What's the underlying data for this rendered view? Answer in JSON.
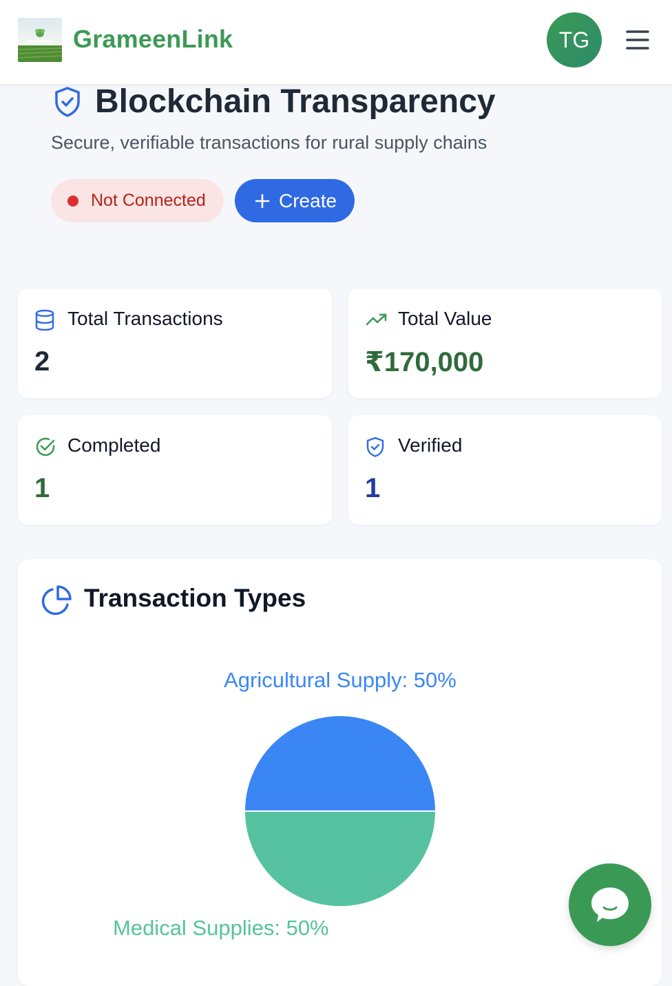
{
  "header": {
    "brand": "GrameenLink",
    "logo_caption": "GrameenLink",
    "avatar_initials": "TG",
    "menu_icon": "hamburger-menu-icon"
  },
  "hero": {
    "title": "Blockchain Transparency",
    "subtitle": "Secure, verifiable transactions for rural supply chains",
    "status_label": "Not Connected",
    "create_label": "Create"
  },
  "stats": [
    {
      "label": "Total Transactions",
      "value": "2",
      "icon": "database-icon",
      "color": "#1f2937"
    },
    {
      "label": "Total Value",
      "value": "₹170,000",
      "icon": "trending-up-icon",
      "color": "#2f6b3a"
    },
    {
      "label": "Completed",
      "value": "1",
      "icon": "check-circle-icon",
      "color": "#2f6b3a"
    },
    {
      "label": "Verified",
      "value": "1",
      "icon": "shield-check-icon",
      "color": "#253e9c"
    }
  ],
  "types": {
    "title": "Transaction Types"
  },
  "chart_data": {
    "type": "pie",
    "title": "",
    "slices": [
      {
        "name": "Agricultural Supply",
        "value": 50,
        "color": "#3b86f5",
        "label": "Agricultural Supply: 50%"
      },
      {
        "name": "Medical Supplies",
        "value": 50,
        "color": "#56c29f",
        "label": "Medical Supplies: 50%"
      }
    ]
  },
  "colors": {
    "brand_green": "#3c9a55",
    "primary_blue": "#2f6ae3",
    "danger": "#dc2f2f"
  }
}
